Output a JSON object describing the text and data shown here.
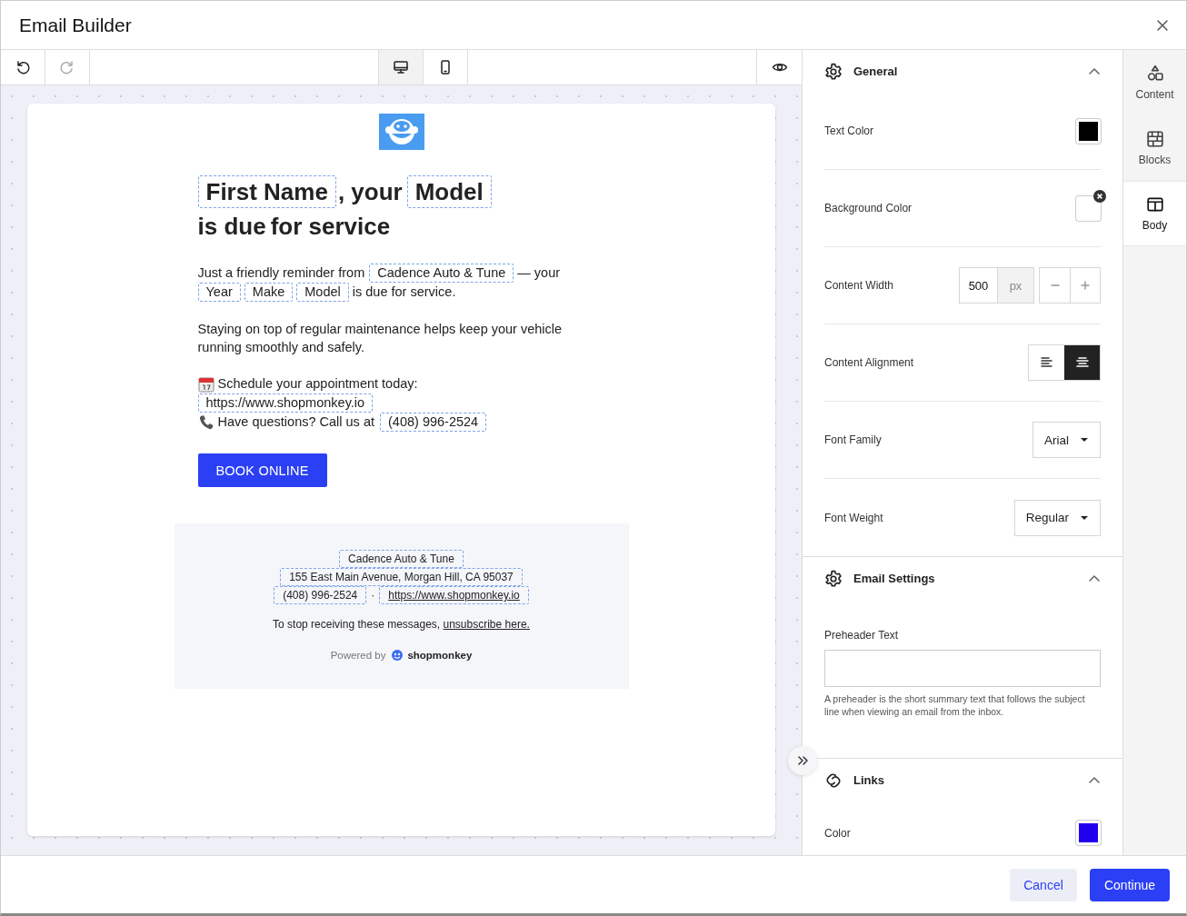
{
  "window": {
    "title": "Email Builder"
  },
  "toolbar": {
    "views": [
      {
        "kind": "desktop",
        "selected": true
      },
      {
        "kind": "mobile",
        "selected": false
      }
    ]
  },
  "email": {
    "heading": [
      {
        "kind": "merge",
        "text": "First Name"
      },
      {
        "kind": "text",
        "text": ", your"
      },
      {
        "kind": "merge",
        "text": "Model"
      },
      {
        "kind": "text",
        "text": "is due"
      },
      {
        "kind": "text",
        "text": "for service"
      }
    ],
    "intro": [
      {
        "kind": "text",
        "text": "Just a friendly reminder from"
      },
      {
        "kind": "merge",
        "text": "Cadence Auto & Tune"
      },
      {
        "kind": "text",
        "text": "— your"
      },
      {
        "kind": "merge",
        "text": "Year"
      },
      {
        "kind": "merge",
        "text": "Make"
      },
      {
        "kind": "merge",
        "text": "Model"
      },
      {
        "kind": "text",
        "text": "is due for service."
      }
    ],
    "body": "Staying on top of regular maintenance helps keep your vehicle running smoothly and safely.",
    "schedule": {
      "text": "Schedule your appointment today:",
      "link": "https://www.shopmonkey.io"
    },
    "questions": {
      "text": "Have questions? Call us at",
      "phone": "(408) 996-2524"
    },
    "button": "BOOK ONLINE",
    "footer": {
      "business": "Cadence Auto & Tune",
      "address": "155 East Main Avenue, Morgan Hill, CA 95037",
      "phone": "(408) 996-2524",
      "separator": "·",
      "website": "https://www.shopmonkey.io",
      "unsubscribe_text": "To stop receiving these messages,",
      "unsubscribe_link": "unsubscribe here.",
      "powered_by": "Powered by",
      "brand": "shopmonkey"
    }
  },
  "panel": {
    "sections": [
      {
        "title": "General",
        "kind": "gear",
        "expanded": true,
        "fields": [
          {
            "kind": "color",
            "label": "Text Color",
            "color": "#000000",
            "clearable": false
          },
          {
            "kind": "color",
            "label": "Background Color",
            "color": "#ffffff",
            "clearable": true
          },
          {
            "kind": "number",
            "label": "Content Width",
            "value": "500",
            "unit": "px"
          },
          {
            "kind": "align",
            "label": "Content Alignment",
            "options": [
              {
                "kind": "left",
                "selected": false
              },
              {
                "kind": "center",
                "selected": true
              }
            ]
          },
          {
            "kind": "select",
            "label": "Font Family",
            "value": "Arial"
          },
          {
            "kind": "select",
            "label": "Font Weight",
            "value": "Regular"
          }
        ]
      },
      {
        "title": "Email Settings",
        "kind": "gear",
        "expanded": true,
        "fields": [
          {
            "kind": "textarea",
            "label": "Preheader Text",
            "help": "A preheader is the short summary text that follows the subject line when viewing an email from the inbox."
          }
        ]
      },
      {
        "title": "Links",
        "kind": "link",
        "expanded": true,
        "fields": [
          {
            "kind": "color",
            "label": "Color",
            "color": "#2200ee",
            "clearable": false
          }
        ]
      }
    ]
  },
  "rail": [
    {
      "kind": "content",
      "label": "Content",
      "selected": false
    },
    {
      "kind": "blocks",
      "label": "Blocks",
      "selected": false
    },
    {
      "kind": "body",
      "label": "Body",
      "selected": true
    }
  ],
  "footer": {
    "buttons": [
      {
        "kind": "secondary",
        "label": "Cancel"
      },
      {
        "kind": "primary",
        "label": "Continue"
      }
    ]
  }
}
